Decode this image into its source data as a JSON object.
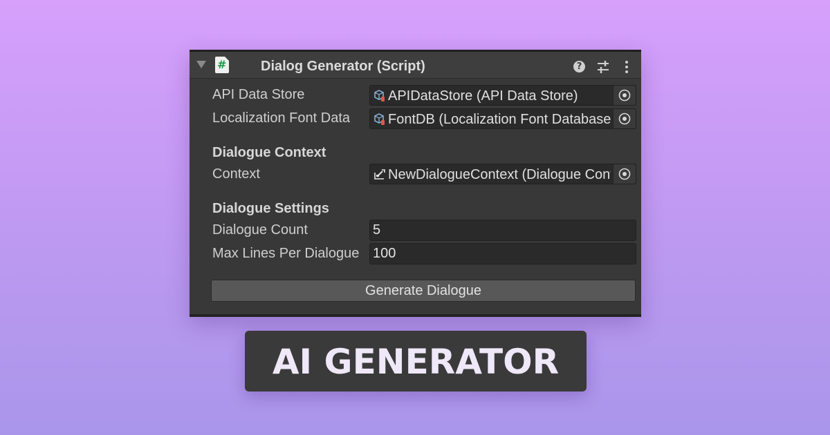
{
  "component": {
    "title": "Dialog Generator (Script)",
    "script_icon_glyph": "#",
    "icons": [
      "fold-arrow-icon",
      "csharp-script-icon",
      "help-icon",
      "preset-sliders-icon",
      "kebab-menu-icon"
    ]
  },
  "fields": {
    "api_data_store": {
      "label": "API Data Store",
      "value": "APIDataStore (API Data Store)",
      "icon": "scriptable-object-icon"
    },
    "localization_font": {
      "label": "Localization Font Data",
      "value": "FontDB (Localization Font Database)",
      "icon": "scriptable-object-icon"
    }
  },
  "dialogue_context": {
    "header": "Dialogue Context",
    "context": {
      "label": "Context",
      "value": "NewDialogueContext (Dialogue Context)",
      "icon": "dialogue-context-asset-icon"
    }
  },
  "dialogue_settings": {
    "header": "Dialogue Settings",
    "dialogue_count": {
      "label": "Dialogue Count",
      "value": "5"
    },
    "max_lines": {
      "label": "Max Lines Per Dialogue",
      "value": "100"
    }
  },
  "actions": {
    "generate_label": "Generate Dialogue"
  },
  "caption": {
    "text": "AI GENERATOR"
  },
  "colors": {
    "background_top": "#d6a0fb",
    "background_bottom": "#a996ea",
    "panel": "#383838",
    "field": "#2a2a2a",
    "button": "#585858",
    "script_icon_green": "#1a9944"
  }
}
